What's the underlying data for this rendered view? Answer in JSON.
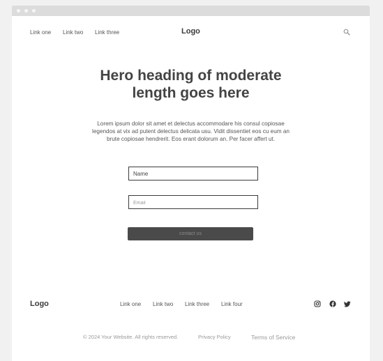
{
  "nav": {
    "links": [
      "Link one",
      "Link two",
      "Link three"
    ],
    "logo": "Logo",
    "search_icon": "search-icon"
  },
  "hero": {
    "title": "Hero heading of moderate length goes here",
    "text": "Lorem ipsum dolor sit amet et delectus accommodare his consul copiosae legendos at vix ad putent delectus delicata usu. Vidit dissentiet eos cu eum an brute copiosae hendrerit. Eos erant dolorum an. Per facer affert ut."
  },
  "form": {
    "name_placeholder": "Name",
    "email_placeholder": "Email",
    "submit_label": "contact us"
  },
  "footer": {
    "logo": "Logo",
    "links": [
      "Link one",
      "Link two",
      "Link three",
      "Link four"
    ],
    "social_icons": [
      "instagram-icon",
      "facebook-icon",
      "twitter-icon"
    ],
    "copyright": "© 2024 Your Website. All rights reserved.",
    "privacy": "Privacy Policy",
    "terms": "Terms of Service"
  },
  "colors": {
    "background": "#f1f1f1",
    "titlebar": "#dcdcdc",
    "button": "#4a4a4a",
    "text": "#3d3d3d"
  }
}
